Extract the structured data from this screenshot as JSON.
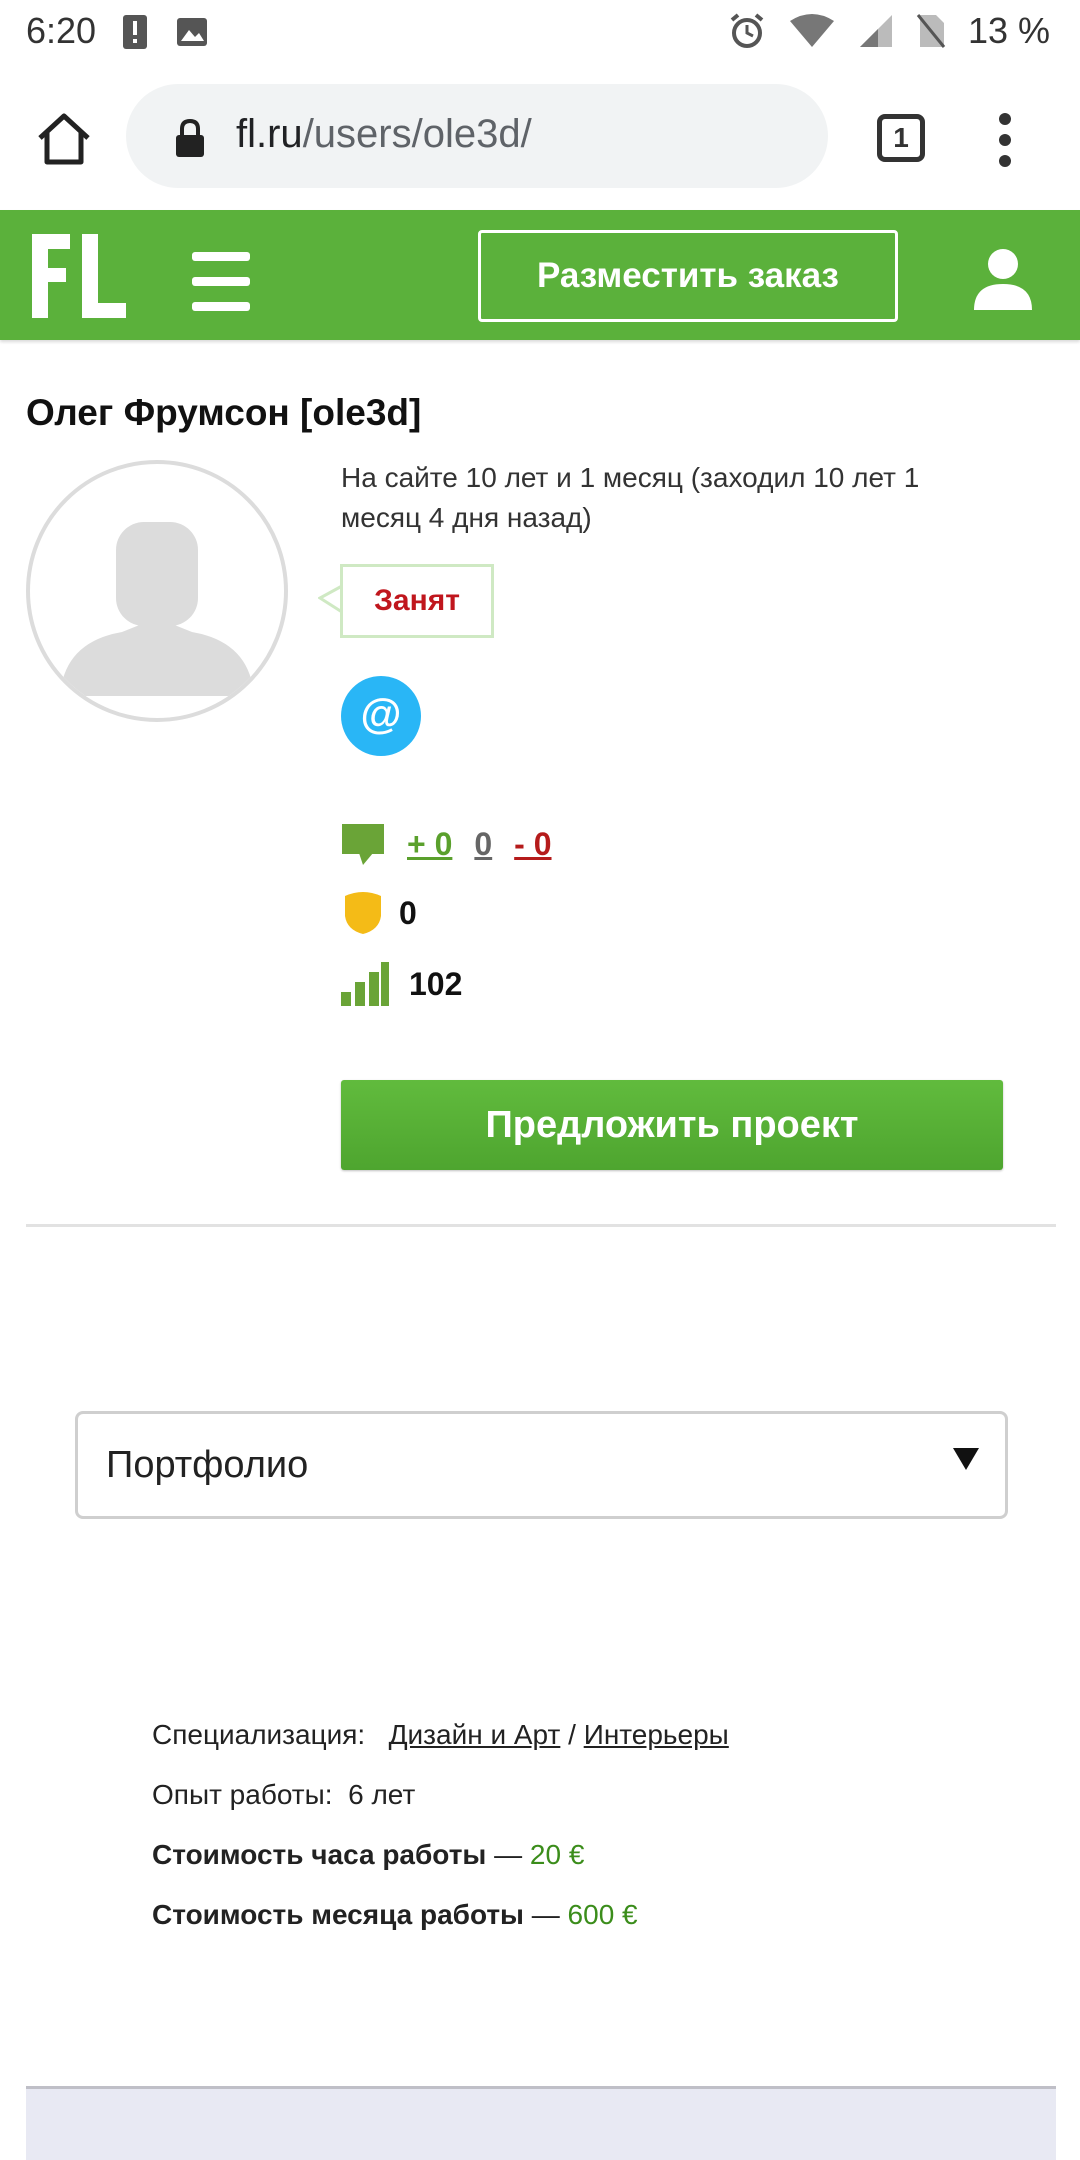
{
  "status_bar": {
    "time": "6:20",
    "battery": "13 %",
    "icons": [
      "alert-icon",
      "image-icon",
      "alarm-icon",
      "wifi-icon",
      "signal-icon",
      "no-sim-icon"
    ]
  },
  "browser": {
    "url_host": "fl.ru",
    "url_path": "/users/ole3d/",
    "tab_count": "1"
  },
  "header": {
    "logo": "FL",
    "order_button": "Разместить заказ",
    "brand_color": "#5bb13b"
  },
  "profile": {
    "name": "Олег Фрумсон [ole3d]",
    "site_since": "На сайте 10 лет и 1 месяц (заходил 10 лет 1 месяц 4 дня назад)",
    "status": "Занят",
    "email_icon": "@",
    "reviews": {
      "positive": "+ 0",
      "neutral": "0",
      "negative": "- 0"
    },
    "shield_value": "0",
    "rating": "102",
    "propose_button": "Предложить проект"
  },
  "portfolio": {
    "selected": "Портфолио"
  },
  "info": {
    "specialization_label": "Специализация:",
    "specialization_category": "Дизайн и Арт",
    "separator": "/",
    "specialization_sub": "Интерьеры",
    "experience_label": "Опыт работы:",
    "experience_value": "6 лет",
    "hour_price_label": "Стоимость часа работы",
    "hour_price_dash": "—",
    "hour_price_value": "20 €",
    "month_price_label": "Стоимость месяца работы",
    "month_price_dash": "—",
    "month_price_value": "600 €"
  }
}
